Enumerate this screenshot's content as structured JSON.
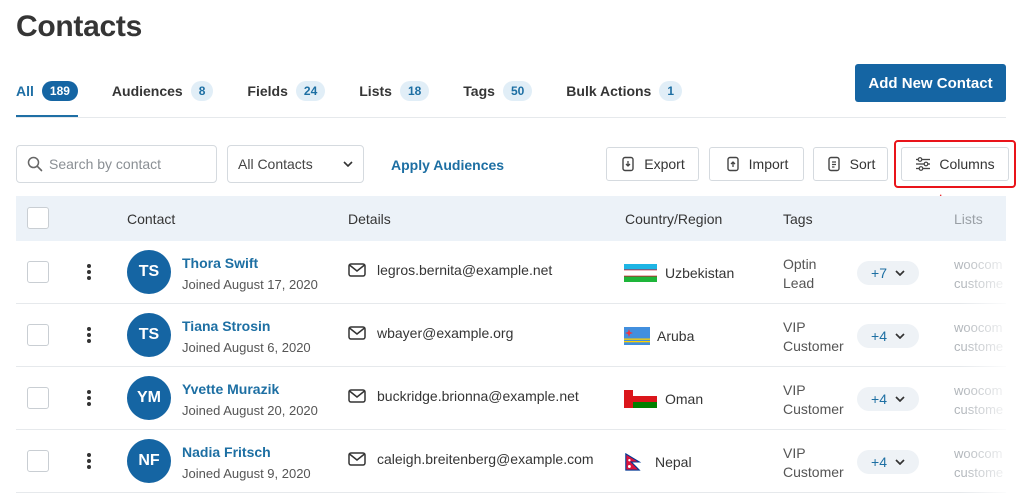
{
  "page": {
    "title": "Contacts"
  },
  "tabs": [
    {
      "label": "All",
      "count": "189"
    },
    {
      "label": "Audiences",
      "count": "8"
    },
    {
      "label": "Fields",
      "count": "24"
    },
    {
      "label": "Lists",
      "count": "18"
    },
    {
      "label": "Tags",
      "count": "50"
    },
    {
      "label": "Bulk Actions",
      "count": "1"
    }
  ],
  "header": {
    "add_button": "Add New Contact"
  },
  "toolbar": {
    "search_placeholder": "Search by contact",
    "audience_select": "All Contacts",
    "apply_link": "Apply Audiences",
    "export": "Export",
    "import": "Import",
    "sort": "Sort",
    "columns": "Columns"
  },
  "table": {
    "columns": {
      "contact": "Contact",
      "details": "Details",
      "country": "Country/Region",
      "tags": "Tags",
      "lists": "Lists"
    },
    "rows": [
      {
        "initials": "TS",
        "name": "Thora Swift",
        "joined": "Joined August 17, 2020",
        "email": "legros.bernita@example.net",
        "country": "Uzbekistan",
        "tag1": "Optin",
        "tag2": "Lead",
        "more": "+7",
        "list1": "woocom",
        "list2": "custome"
      },
      {
        "initials": "TS",
        "name": "Tiana Strosin",
        "joined": "Joined August 6, 2020",
        "email": "wbayer@example.org",
        "country": "Aruba",
        "tag1": "VIP",
        "tag2": "Customer",
        "more": "+4",
        "list1": "woocom",
        "list2": "custome"
      },
      {
        "initials": "YM",
        "name": "Yvette Murazik",
        "joined": "Joined August 20, 2020",
        "email": "buckridge.brionna@example.net",
        "country": "Oman",
        "tag1": "VIP",
        "tag2": "Customer",
        "more": "+4",
        "list1": "woocom",
        "list2": "custome"
      },
      {
        "initials": "NF",
        "name": "Nadia Fritsch",
        "joined": "Joined August 9, 2020",
        "email": "caleigh.breitenberg@example.com",
        "country": "Nepal",
        "tag1": "VIP",
        "tag2": "Customer",
        "more": "+4",
        "list1": "woocom",
        "list2": "custome"
      }
    ]
  },
  "colors": {
    "primary": "#1565a3",
    "link": "#1d6fa3",
    "highlight": "#e9141a",
    "header_bg": "#ecf2f8"
  }
}
